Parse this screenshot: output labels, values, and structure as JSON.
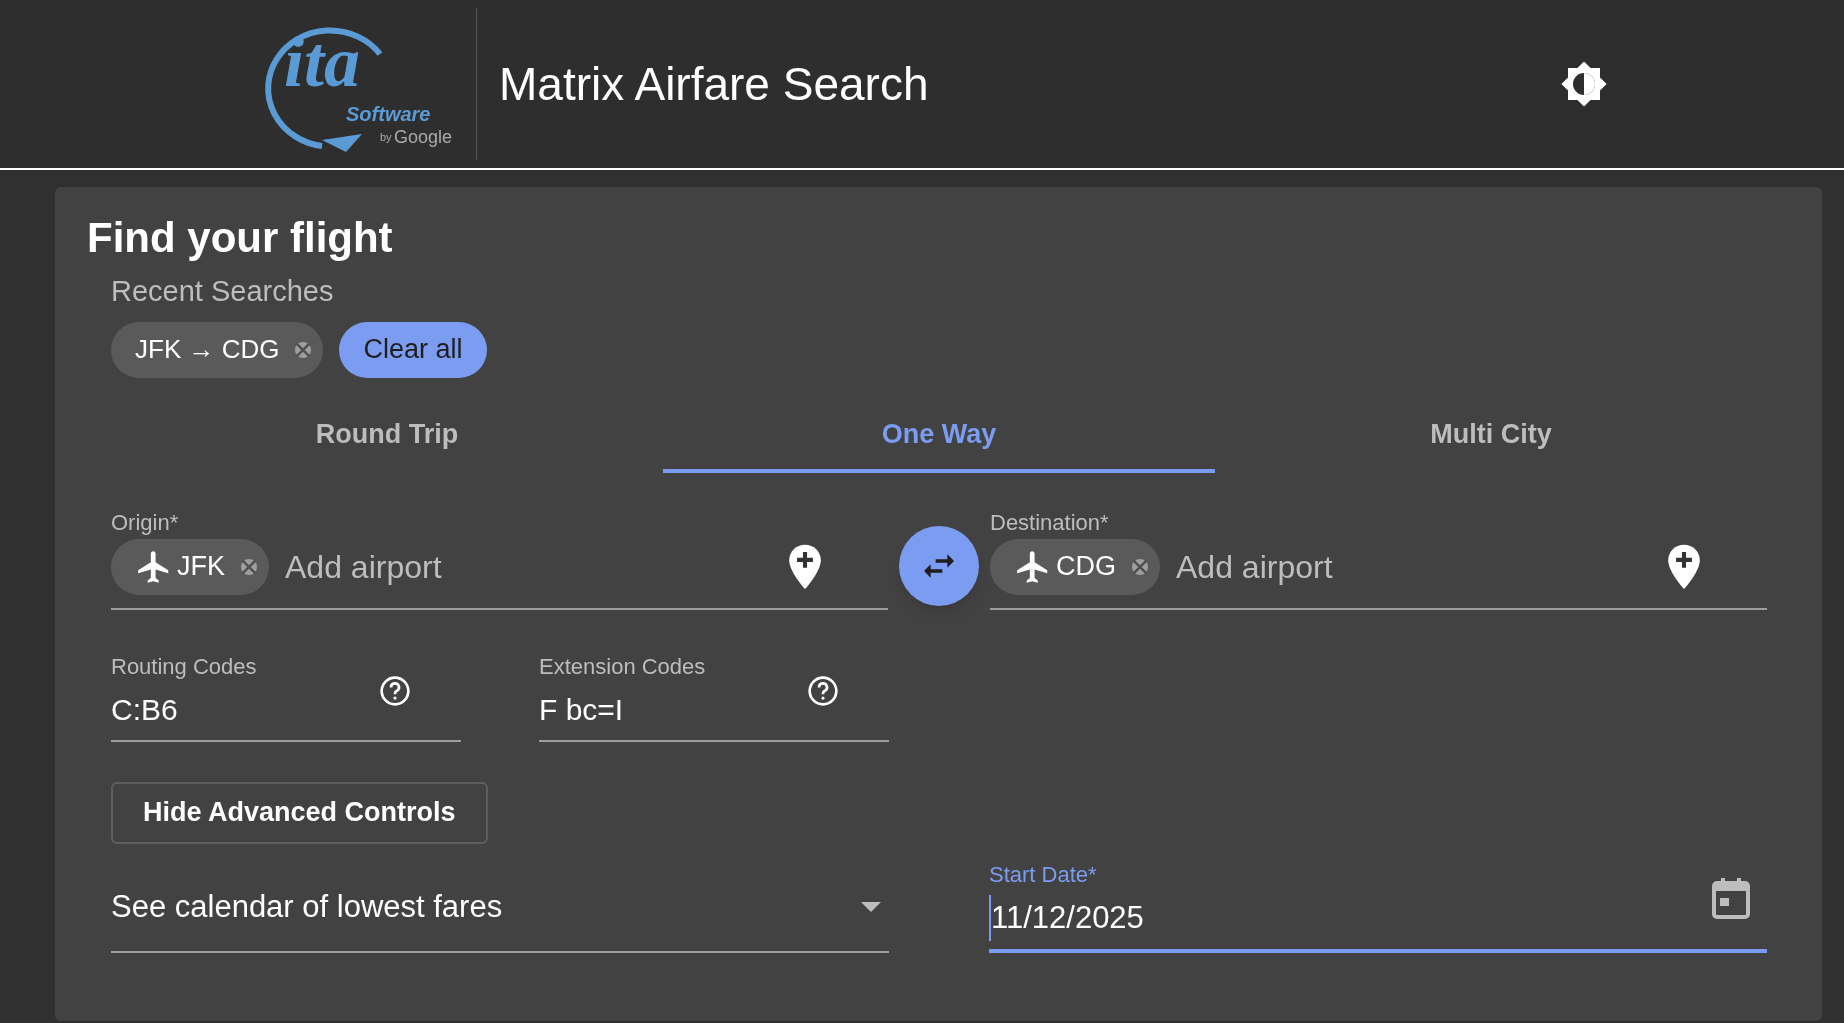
{
  "header": {
    "logo": {
      "mark": "ita",
      "software": "Software",
      "by": "by",
      "google": "Google"
    },
    "title": "Matrix Airfare Search"
  },
  "card": {
    "title": "Find your flight",
    "recent_searches": {
      "label": "Recent Searches",
      "chips": [
        {
          "text": "JFK → CDG"
        }
      ],
      "clear_button": "Clear all"
    },
    "tabs": [
      {
        "label": "Round Trip",
        "selected": false
      },
      {
        "label": "One Way",
        "selected": true
      },
      {
        "label": "Multi City",
        "selected": false
      }
    ],
    "origin": {
      "label": "Origin*",
      "chips": [
        {
          "code": "JFK"
        }
      ],
      "placeholder": "Add airport"
    },
    "destination": {
      "label": "Destination*",
      "chips": [
        {
          "code": "CDG"
        }
      ],
      "placeholder": "Add airport"
    },
    "routing_codes": {
      "label": "Routing Codes",
      "value": "C:B6"
    },
    "extension_codes": {
      "label": "Extension Codes",
      "value": "F bc=I"
    },
    "advanced_button": "Hide Advanced Controls",
    "fare_view": {
      "value": "See calendar of lowest fares"
    },
    "start_date": {
      "label": "Start Date*",
      "value": "11/12/2025",
      "focused": true
    }
  }
}
